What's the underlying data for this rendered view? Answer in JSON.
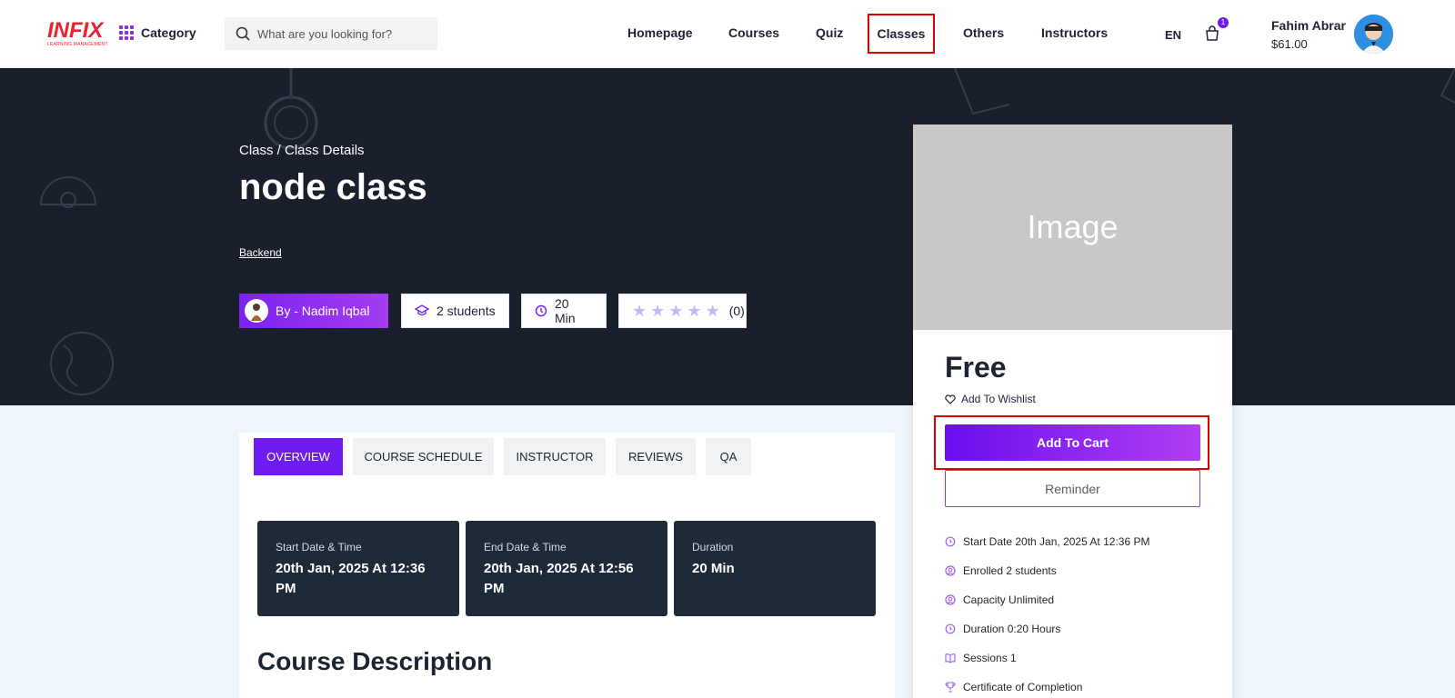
{
  "header": {
    "logo_text": "INFIX",
    "logo_sub": "LEARNING MANAGEMENT",
    "category_label": "Category",
    "search_placeholder": "What are you looking for?",
    "nav": [
      "Homepage",
      "Courses",
      "Quiz",
      "Classes",
      "Others",
      "Instructors"
    ],
    "active_nav": "Classes",
    "language": "EN",
    "cart_count": "1",
    "user_name": "Fahim Abrar",
    "user_balance": "$61.00"
  },
  "hero": {
    "breadcrumb": "Class / Class Details",
    "title": "node class",
    "tag": "Backend",
    "by_label": "By - Nadim Iqbal",
    "students": "2 students",
    "duration": "20 Min",
    "rating_count": "(0)",
    "rating_value": 0
  },
  "tabs": [
    "OVERVIEW",
    "COURSE SCHEDULE",
    "INSTRUCTOR",
    "REVIEWS",
    "QA"
  ],
  "info": [
    {
      "label": "Start Date & Time",
      "value": "20th Jan, 2025 At 12:36 PM"
    },
    {
      "label": "End Date & Time",
      "value": "20th Jan, 2025 At 12:56 PM"
    },
    {
      "label": "Duration",
      "value": "20 Min"
    }
  ],
  "course_description_heading": "Course Description",
  "side": {
    "image_label": "Image",
    "price": "Free",
    "wishlist": "Add To Wishlist",
    "add_to_cart": "Add To Cart",
    "reminder": "Reminder",
    "meta": [
      {
        "icon": "clock-icon",
        "text": "Start Date 20th Jan, 2025 At 12:36 PM"
      },
      {
        "icon": "user-icon",
        "text": "Enrolled 2 students"
      },
      {
        "icon": "user-icon",
        "text": "Capacity Unlimited"
      },
      {
        "icon": "clock-icon",
        "text": "Duration 0:20 Hours"
      },
      {
        "icon": "book-icon",
        "text": "Sessions 1"
      },
      {
        "icon": "trophy-icon",
        "text": "Certificate of Completion"
      }
    ]
  },
  "colors": {
    "accent": "#6f1cf2",
    "hero_bg": "#1a1f2c",
    "highlight": "#e10000"
  }
}
